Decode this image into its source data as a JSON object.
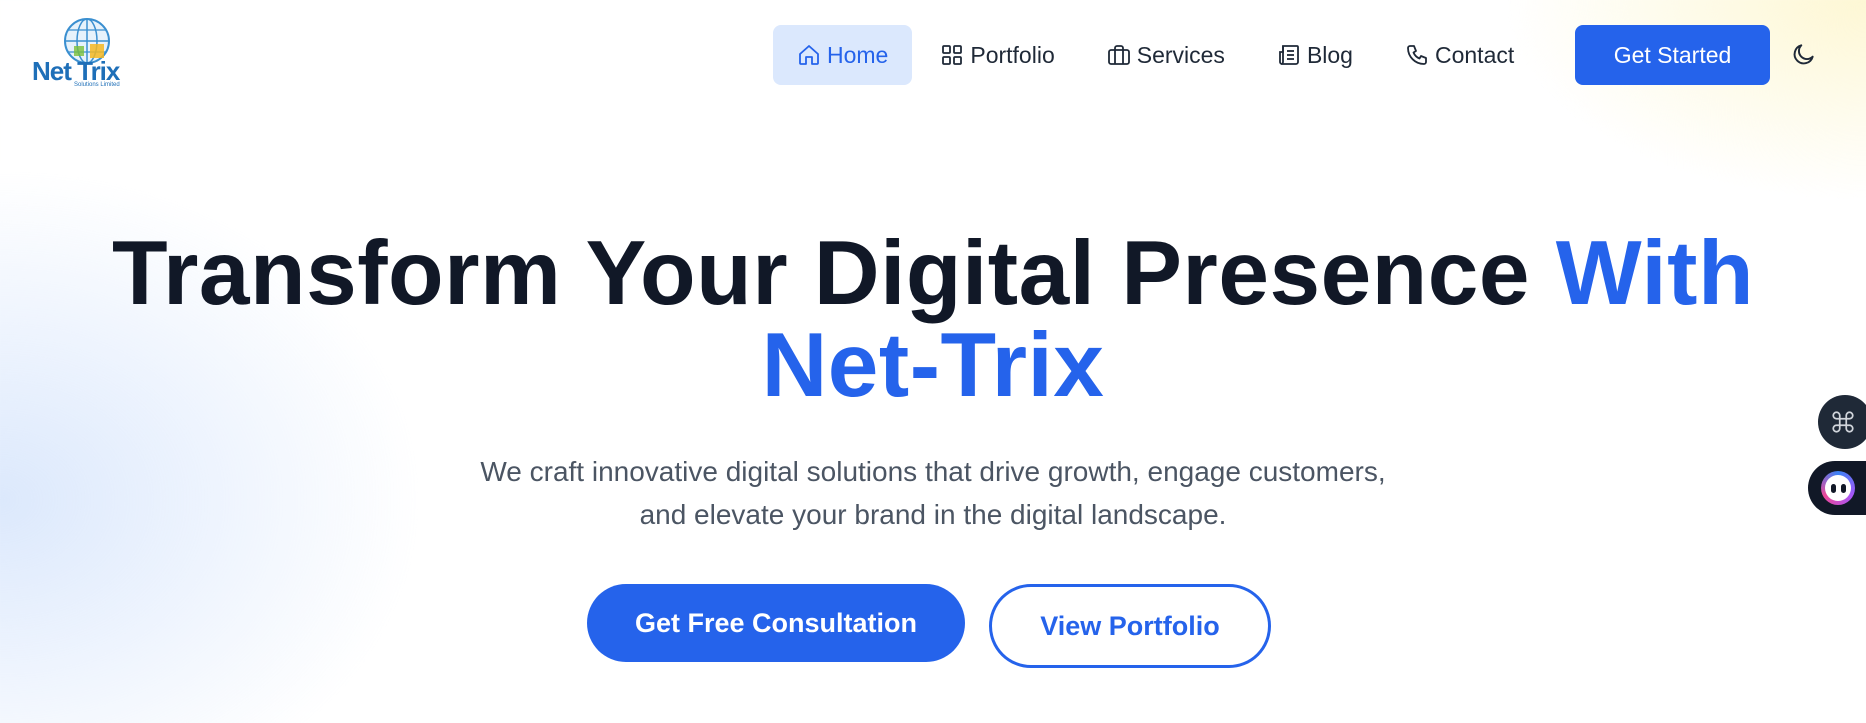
{
  "logo": {
    "name": "Net Trix",
    "tagline": "Solutions Limited"
  },
  "nav": {
    "items": [
      {
        "label": "Home",
        "icon": "home-icon",
        "active": true
      },
      {
        "label": "Portfolio",
        "icon": "grid-icon",
        "active": false
      },
      {
        "label": "Services",
        "icon": "briefcase-icon",
        "active": false
      },
      {
        "label": "Blog",
        "icon": "newspaper-icon",
        "active": false
      },
      {
        "label": "Contact",
        "icon": "phone-icon",
        "active": false
      }
    ],
    "cta_label": "Get Started",
    "theme_icon": "moon-icon"
  },
  "hero": {
    "title_main": "Transform Your Digital Presence",
    "title_accent_1": "With",
    "title_accent_2": "Net-Trix",
    "subtitle_line1": "We craft innovative digital solutions that drive growth, engage customers,",
    "subtitle_line2": "and elevate your brand in the digital landscape.",
    "primary_button": "Get Free Consultation",
    "secondary_button": "View Portfolio"
  },
  "floating": {
    "command_icon": "command-icon",
    "assistant_icon": "chatbot-icon"
  },
  "colors": {
    "accent": "#2563eb",
    "active_nav_bg": "#dbe8fd",
    "heading": "#111827",
    "body_text": "#4b5563"
  }
}
